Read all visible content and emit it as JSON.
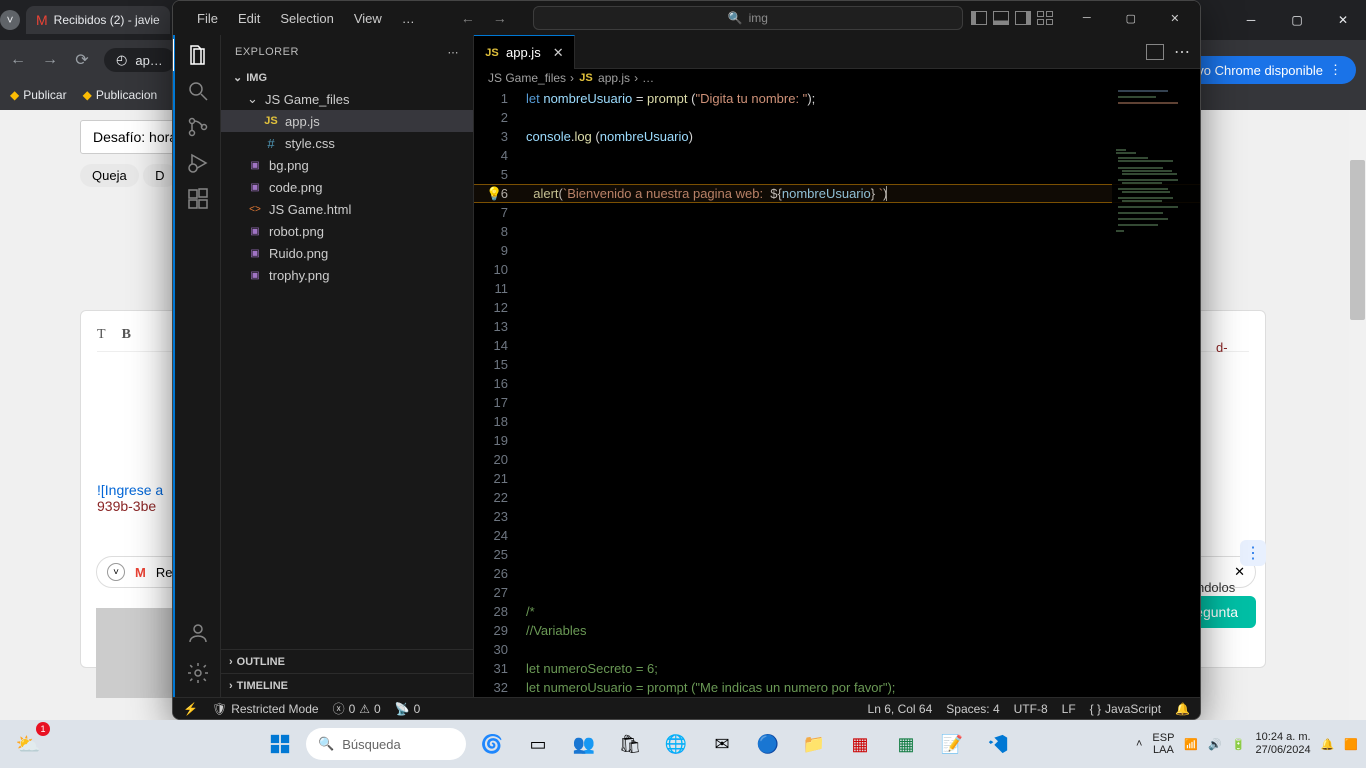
{
  "chrome": {
    "tab_title": "Recibidos (2) - javie",
    "url_display": "ap…",
    "bookmarks": [
      "Publicar",
      "Publicacion"
    ],
    "update_btn": "uevo Chrome disponible",
    "forum_input": "Desafío: hora d",
    "tags": [
      "Queja",
      "D"
    ],
    "toolbar_items": [
      "T",
      "B"
    ],
    "post_link_left": "![Ingrese a",
    "post_link_line2": "939b-3be",
    "reply_prefix": "Re",
    "publicar": "Publicar",
    "right_text_1": "d-",
    "right_text_2": "oltándolos",
    "ask": "regunta"
  },
  "vscode": {
    "menu": [
      "File",
      "Edit",
      "Selection",
      "View",
      "…"
    ],
    "search_text": "img",
    "explorer_title": "EXPLORER",
    "root_folder": "IMG",
    "tree": [
      {
        "name": "JS Game_files",
        "type": "folder",
        "depth": 1,
        "expanded": true
      },
      {
        "name": "app.js",
        "type": "js",
        "depth": 2,
        "selected": true
      },
      {
        "name": "style.css",
        "type": "css",
        "depth": 2
      },
      {
        "name": "bg.png",
        "type": "img",
        "depth": 1
      },
      {
        "name": "code.png",
        "type": "img",
        "depth": 1
      },
      {
        "name": "JS Game.html",
        "type": "html",
        "depth": 1
      },
      {
        "name": "robot.png",
        "type": "img",
        "depth": 1
      },
      {
        "name": "Ruido.png",
        "type": "img",
        "depth": 1
      },
      {
        "name": "trophy.png",
        "type": "img",
        "depth": 1
      }
    ],
    "outline": "OUTLINE",
    "timeline": "TIMELINE",
    "tab_name": "app.js",
    "breadcrumb": [
      "JS Game_files",
      "app.js",
      "…"
    ],
    "line_count": 32,
    "current_line": 6,
    "code": {
      "l1_let": "let ",
      "l1_var": "nombreUsuario",
      "l1_eq": " = ",
      "l1_fn": "prompt",
      "l1_p1": " (",
      "l1_str": "\"Digita tu nombre: \"",
      "l1_p2": ");",
      "l3_obj": "console",
      "l3_dot": ".",
      "l3_fn": "log",
      "l3_p1": " (",
      "l3_var": "nombreUsuario",
      "l3_p2": ")",
      "l6_fn": "alert",
      "l6_p1": "(",
      "l6_t1": "`Bienvenido a nuestra pagina web:  ",
      "l6_t2": "${",
      "l6_var": "nombreUsuario",
      "l6_t3": "}",
      "l6_t4": " `",
      "l6_p2": ")",
      "l28": "/*",
      "l29": "//Variables",
      "l31_let": "let ",
      "l31_var": "numeroSecreto",
      "l31_eq": " = ",
      "l31_num": "6",
      "l31_sc": ";",
      "l32_let": "let ",
      "l32_var": "numeroUsuario",
      "l32_eq": " = ",
      "l32_fn": "prompt",
      "l32_p1": " (",
      "l32_str": "\"Me indicas un numero por favor\"",
      "l32_p2": ");"
    },
    "status": {
      "restricted": "Restricted Mode",
      "errors": "0",
      "warnings": "0",
      "port": "0",
      "ln_col": "Ln 6, Col 64",
      "spaces": "Spaces: 4",
      "encoding": "UTF-8",
      "eol": "LF",
      "lang": "JavaScript"
    }
  },
  "taskbar": {
    "search_placeholder": "Búsqueda",
    "lang1": "ESP",
    "lang2": "LAA",
    "time": "10:24 a. m.",
    "date": "27/06/2024",
    "weather_badge": "1"
  }
}
